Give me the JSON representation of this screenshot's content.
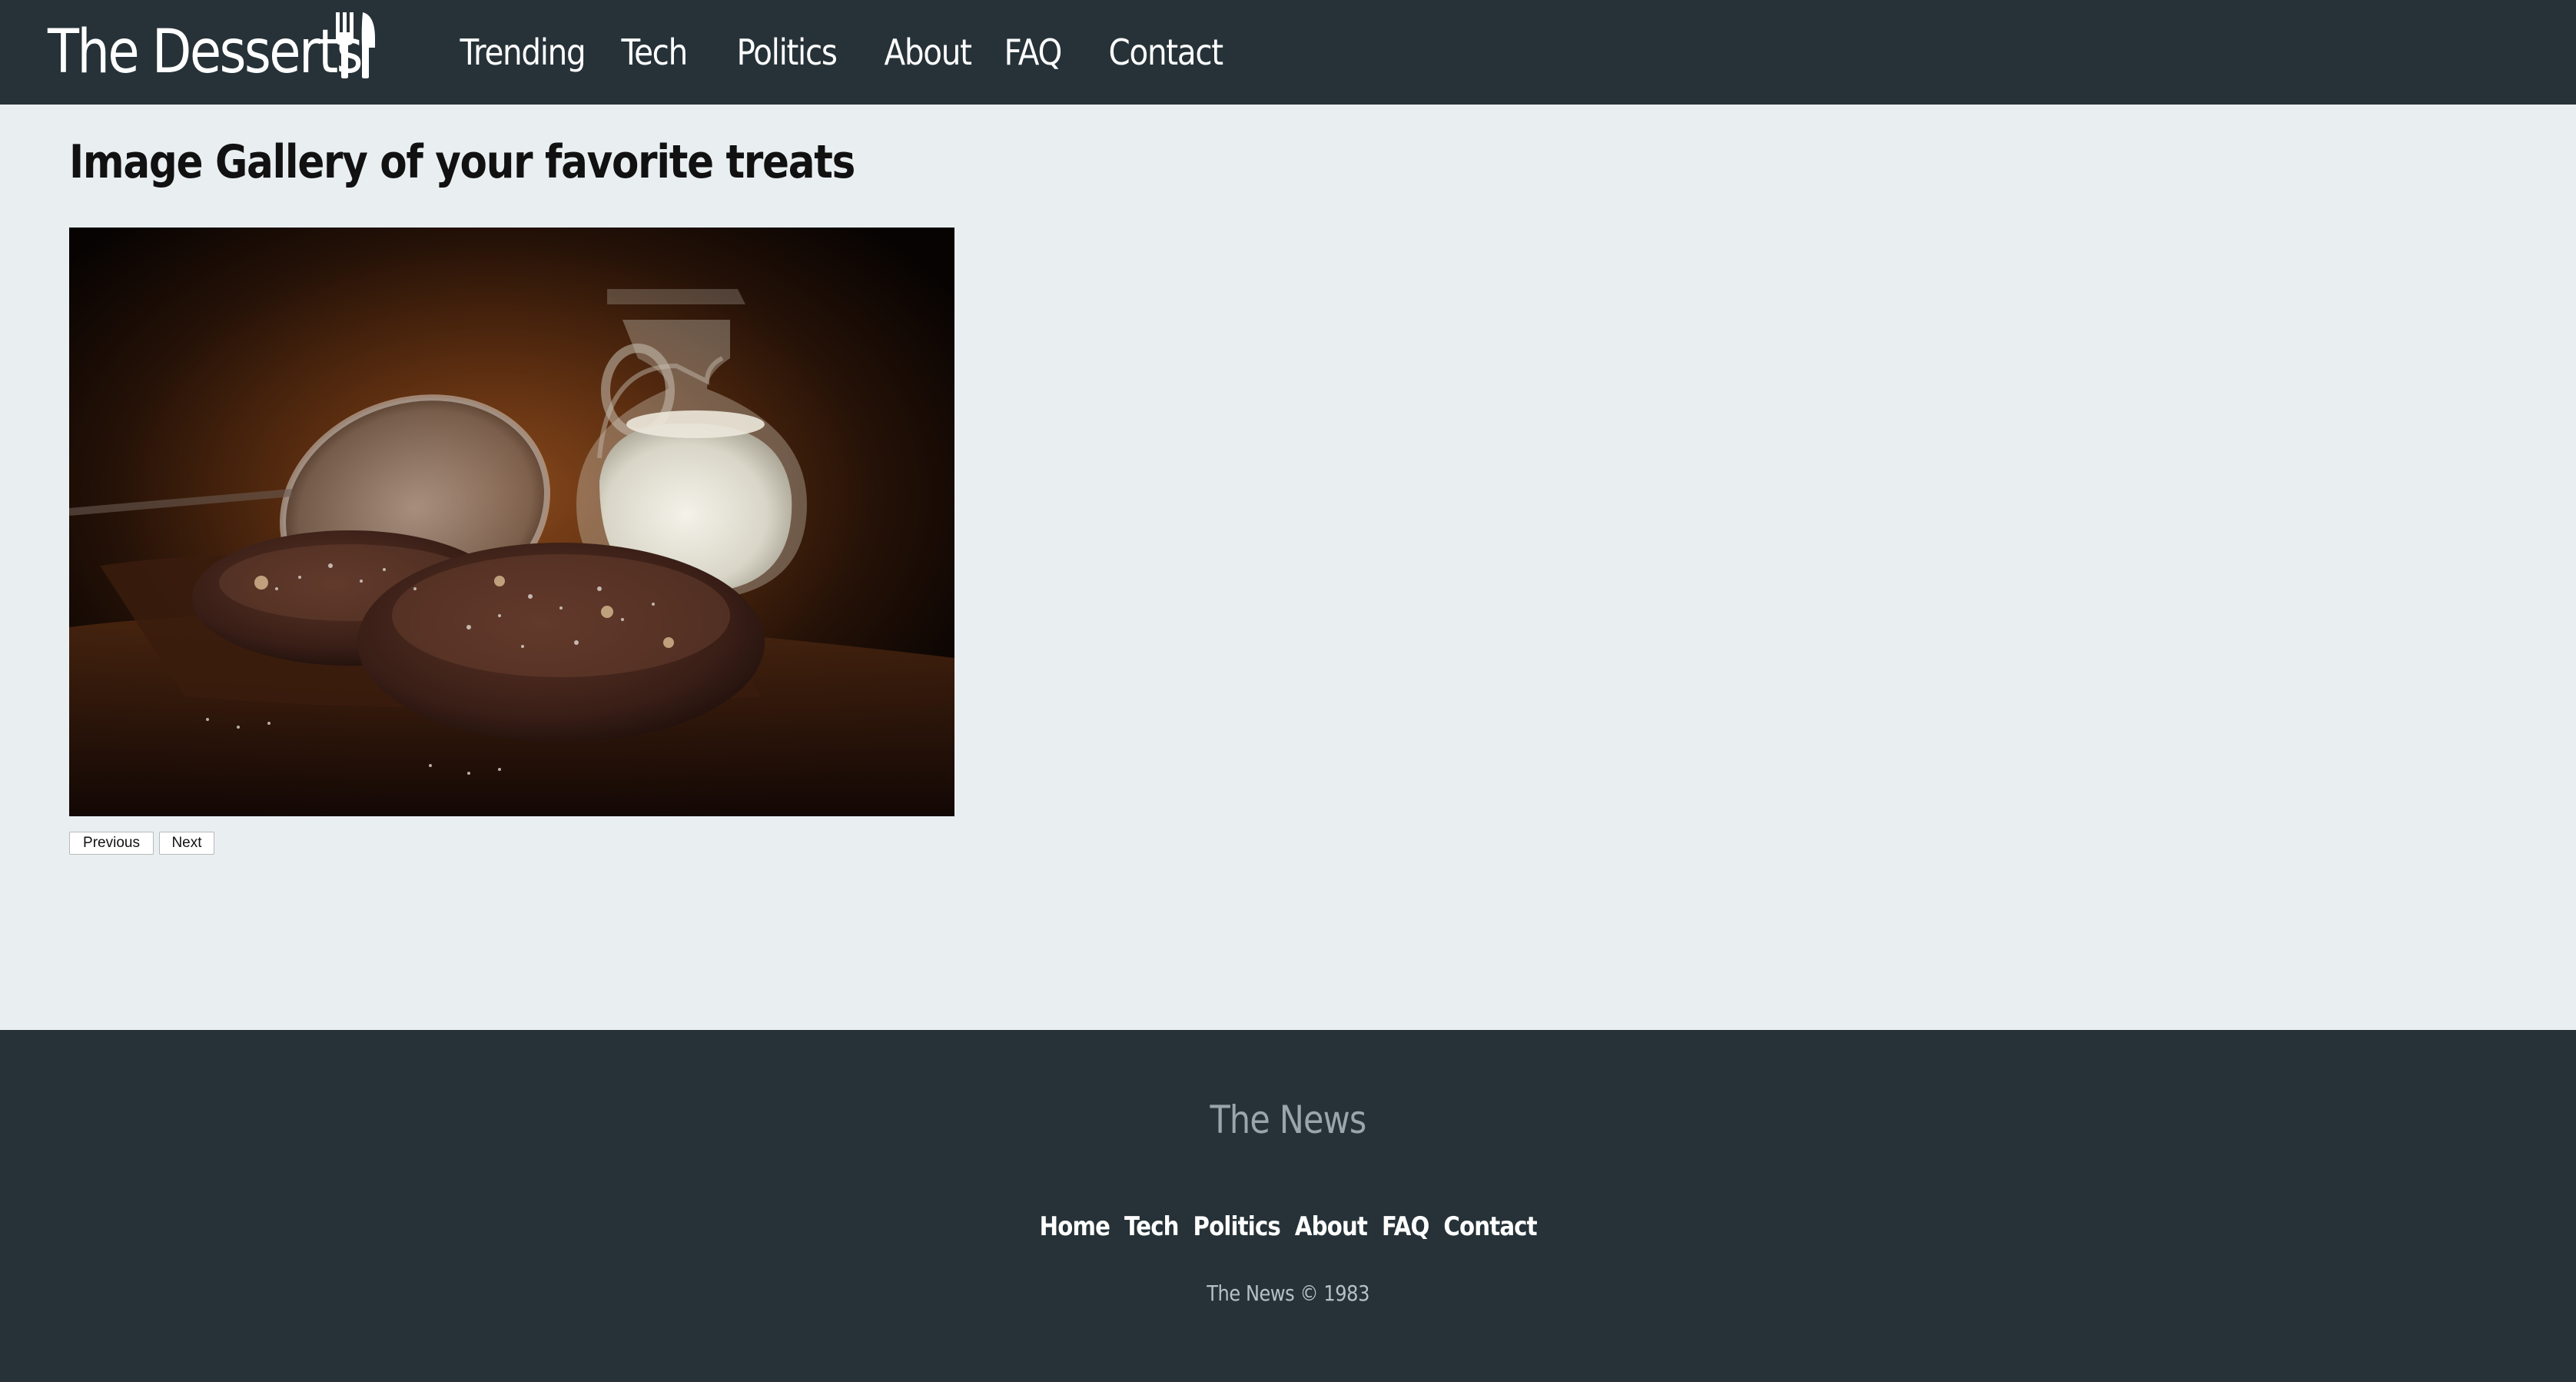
{
  "header": {
    "brand": "The Desserts",
    "brand_icon": "fork-knife-icon",
    "nav": [
      {
        "label": "Trending"
      },
      {
        "label": "Tech"
      },
      {
        "label": "Politics"
      },
      {
        "label": "About"
      },
      {
        "label": "FAQ"
      },
      {
        "label": "Contact"
      }
    ]
  },
  "main": {
    "title": "Image Gallery of your favorite treats",
    "image": {
      "subject": "chocolate cookies with powdered sugar, milk jug and sieve"
    },
    "previous_label": "Previous",
    "next_label": "Next"
  },
  "footer": {
    "title": "The News",
    "nav": [
      {
        "label": "Home"
      },
      {
        "label": "Tech"
      },
      {
        "label": "Politics"
      },
      {
        "label": "About"
      },
      {
        "label": "FAQ"
      },
      {
        "label": "Contact"
      }
    ],
    "copyright": "The News © 1983"
  },
  "colors": {
    "header_bg": "#263238",
    "page_bg": "#e9eef1",
    "footer_bg": "#263238",
    "footer_title": "#9aa6ac",
    "copyright": "#b6c0c5"
  }
}
